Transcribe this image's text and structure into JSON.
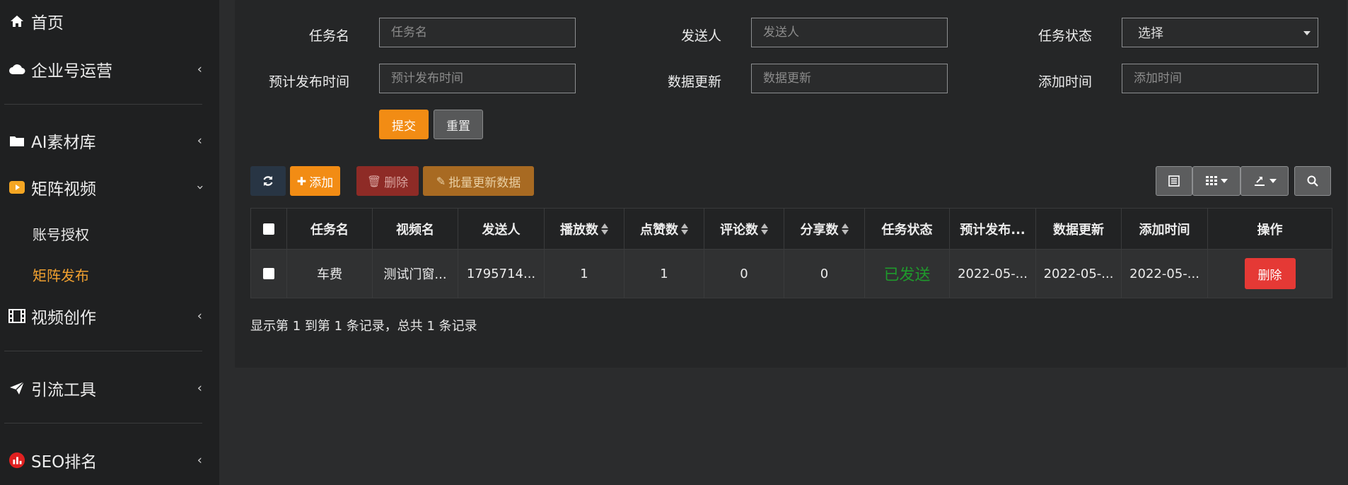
{
  "sidebar": {
    "items": [
      {
        "label": "首页",
        "icon": "home-icon"
      },
      {
        "label": "企业号运营",
        "icon": "cloud-icon"
      },
      {
        "label": "AI素材库",
        "icon": "folder-icon"
      },
      {
        "label": "矩阵视频",
        "icon": "video-play-icon"
      },
      {
        "label": "视频创作",
        "icon": "film-icon"
      },
      {
        "label": "引流工具",
        "icon": "paper-plane-icon"
      },
      {
        "label": "SEO排名",
        "icon": "bar-chart-icon"
      }
    ],
    "sub_items": [
      {
        "label": "账号授权"
      },
      {
        "label": "矩阵发布",
        "active": true
      }
    ],
    "chevron": "‹"
  },
  "filters": {
    "task_name": {
      "label": "任务名",
      "placeholder": "任务名"
    },
    "sender": {
      "label": "发送人",
      "placeholder": "发送人"
    },
    "task_status": {
      "label": "任务状态",
      "value": "选择"
    },
    "scheduled_time": {
      "label": "预计发布时间",
      "placeholder": "预计发布时间"
    },
    "data_update": {
      "label": "数据更新",
      "placeholder": "数据更新"
    },
    "added_time": {
      "label": "添加时间",
      "placeholder": "添加时间"
    },
    "submit_label": "提交",
    "reset_label": "重置"
  },
  "toolbar": {
    "add_label": "添加",
    "delete_label": "删除",
    "batch_update_label": "批量更新数据"
  },
  "table": {
    "columns": [
      "任务名",
      "视频名",
      "发送人",
      "播放数",
      "点赞数",
      "评论数",
      "分享数",
      "任务状态",
      "预计发布...",
      "数据更新",
      "添加时间",
      "操作"
    ],
    "rows": [
      {
        "task_name": "车费",
        "video_name": "测试门窗...",
        "sender": "1795714...",
        "plays": "1",
        "likes": "1",
        "comments": "0",
        "shares": "0",
        "status": "已发送",
        "scheduled": "2022-05-...",
        "data_update": "2022-05-...",
        "added": "2022-05-...",
        "action_label": "删除"
      }
    ]
  },
  "footer": {
    "summary": "显示第 1 到第 1 条记录，总共 1 条记录"
  },
  "colors": {
    "accent": "#f28c14",
    "active_nav": "#f0a030",
    "danger": "#e53935",
    "success": "#1f9a2c"
  }
}
